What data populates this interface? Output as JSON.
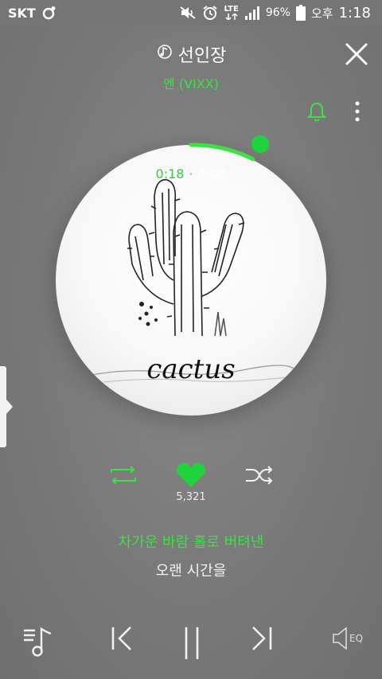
{
  "status_bar": {
    "carrier": "SKT",
    "network": "LTE",
    "battery": "96%",
    "ampm": "오후",
    "time": "1:18"
  },
  "song": {
    "title": "선인장",
    "artist": "엔 (VIXX)"
  },
  "player": {
    "elapsed": "0:18",
    "separator": "·",
    "duration": "4:08",
    "progress_fraction": 0.073
  },
  "album": {
    "art_text": "cactus"
  },
  "actions": {
    "like_count": "5,321"
  },
  "lyrics": {
    "current": "차가운 바람 홀로 버텨낸",
    "next": "오랜 시간을"
  },
  "controls": {
    "eq_label": "EQ"
  },
  "colors": {
    "accent": "#3de142",
    "background": "#7b7b7b"
  },
  "icons": [
    "close-icon",
    "bell-icon",
    "more-vertical-icon",
    "repeat-icon",
    "heart-icon",
    "shuffle-icon",
    "playlist-icon",
    "previous-icon",
    "pause-icon",
    "next-icon",
    "equalizer-icon"
  ]
}
